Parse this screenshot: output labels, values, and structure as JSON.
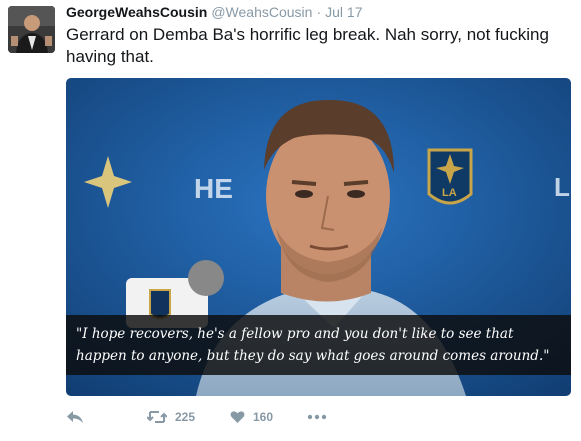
{
  "tweet": {
    "display_name": "GeorgeWeahsCousin",
    "handle": "@WeahsCousin",
    "separator": "·",
    "timestamp": "Jul 17",
    "text": "Gerrard on Demba Ba's horrific leg break. Nah sorry, not fucking having that."
  },
  "media": {
    "backdrop_text_left": "HE",
    "backdrop_text_right": "L",
    "badge_text": "LA",
    "caption": "\"I hope recovers, he's a fellow pro and you don't like to see that happen to anyone, but they do say what goes around comes around.\""
  },
  "actions": {
    "reply_icon": "reply-icon",
    "retweet_icon": "retweet-icon",
    "retweet_count": "225",
    "like_icon": "heart-icon",
    "like_count": "160",
    "more_icon": "more-icon"
  },
  "colors": {
    "text": "#14171a",
    "muted": "#8899a6",
    "backdrop_blue": "#1d5fa8",
    "badge_gold": "#c9a54a"
  }
}
